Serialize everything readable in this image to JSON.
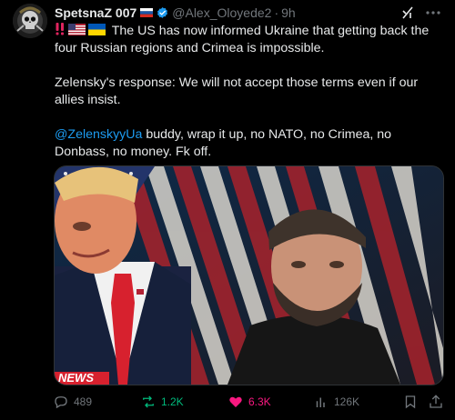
{
  "author": {
    "display_name": "SpetsnaZ 007",
    "handle": "@Alex_Oloyede2",
    "separator": "·",
    "timestamp": "9h"
  },
  "tweet": {
    "line1": "The US has now informed Ukraine that getting back the four Russian regions and Crimea is impossible.",
    "line2": "Zelensky's response: We will not accept those terms even if our allies insist.",
    "mention": "@ZelenskyyUa",
    "line3": " buddy, wrap it up, no NATO, no Crimea, no Donbass, no money. Fk off."
  },
  "media": {
    "overlay_text": "NEWS"
  },
  "actions": {
    "replies": "489",
    "reposts": "1.2K",
    "likes": "6.3K",
    "views": "126K"
  },
  "colors": {
    "background": "#000000",
    "text": "#e7e9ea",
    "muted": "#71767b",
    "link": "#1d9bf0",
    "repost_active": "#00ba7c",
    "like_active": "#f91880"
  },
  "icons": [
    "avatar-skull",
    "flag-russia-icon",
    "verified-badge-icon",
    "grok-icon",
    "more-icon",
    "double-exclamation-icon",
    "flag-us-icon",
    "flag-ukraine-icon",
    "reply-icon",
    "repost-icon",
    "like-icon",
    "views-icon",
    "bookmark-icon",
    "share-icon"
  ]
}
